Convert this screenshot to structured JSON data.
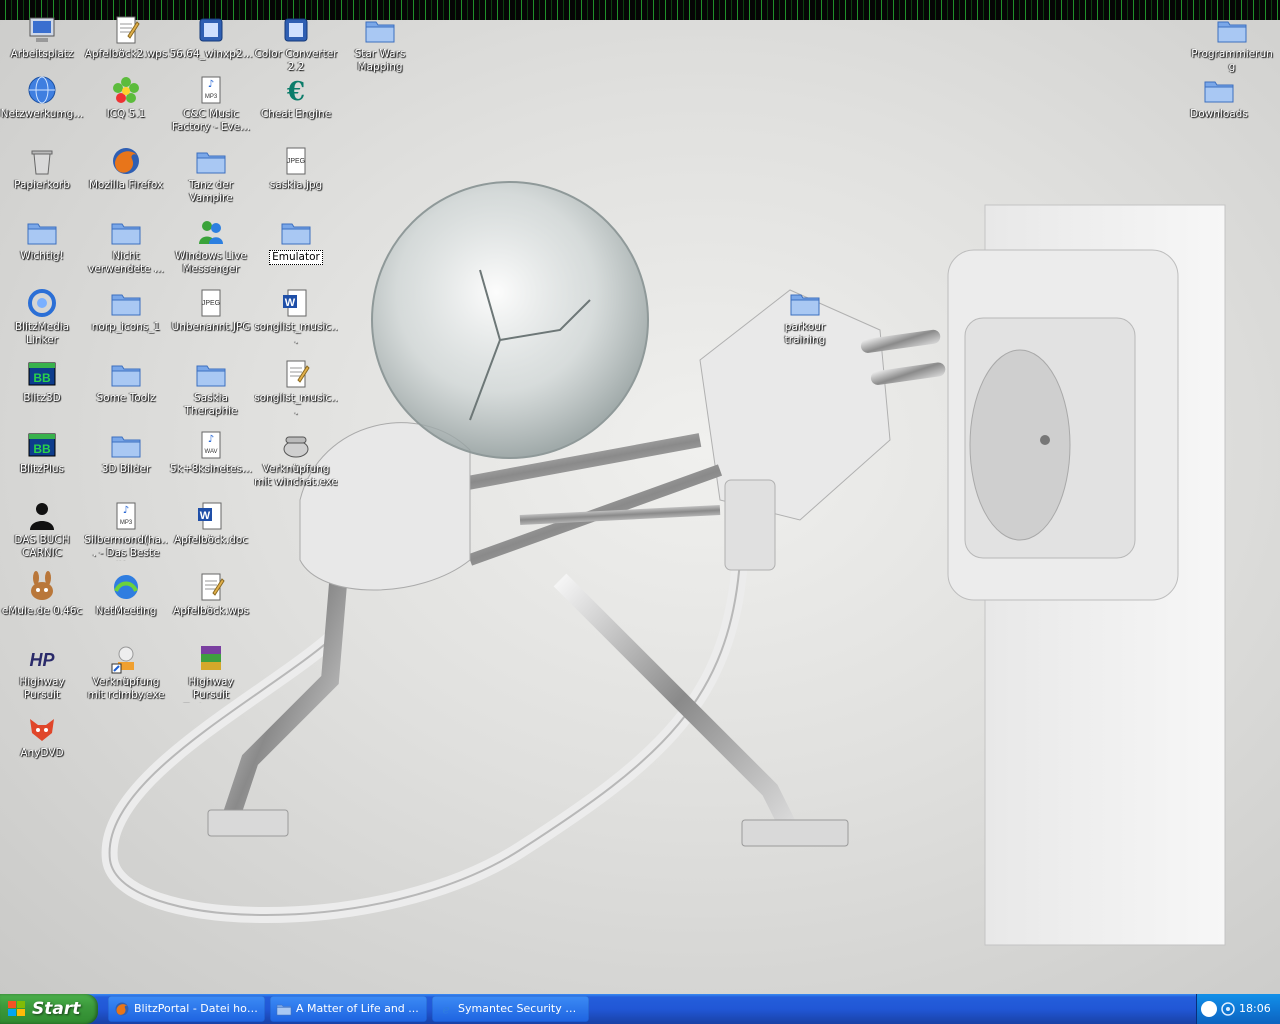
{
  "desktop": {
    "icons": [
      {
        "label": "Arbeitsplatz",
        "icon": "my-computer-icon"
      },
      {
        "label": "Apfelböck2.wps",
        "icon": "document-icon"
      },
      {
        "label": "56.64_winxp2...",
        "icon": "installer-icon"
      },
      {
        "label": "Color Converter 2.2",
        "icon": "app-icon"
      },
      {
        "label": "Star Wars Mapping",
        "icon": "folder-icon"
      },
      {
        "label": "Programmierung",
        "icon": "folder-icon"
      },
      {
        "label": "Netzwerkumg...",
        "icon": "network-icon"
      },
      {
        "label": "ICQ 5.1",
        "icon": "icq-flower-icon"
      },
      {
        "label": "C&C Music Factory - Eve...",
        "icon": "mp3-file-icon"
      },
      {
        "label": "Cheat Engine",
        "icon": "cheat-engine-icon"
      },
      {
        "label": "Downloads",
        "icon": "folder-icon"
      },
      {
        "label": "Papierkorb",
        "icon": "recycle-bin-icon"
      },
      {
        "label": "Mozilla Firefox",
        "icon": "firefox-icon"
      },
      {
        "label": "Tanz der Vampire",
        "icon": "folder-icon"
      },
      {
        "label": "saskia.jpg",
        "icon": "jpeg-file-icon"
      },
      {
        "label": "Wichtig!",
        "icon": "folder-icon"
      },
      {
        "label": "Nicht verwendete ...",
        "icon": "folder-icon"
      },
      {
        "label": "Windows Live Messenger",
        "icon": "messenger-icon"
      },
      {
        "label": "Emulator",
        "icon": "folder-icon"
      },
      {
        "label": "BlitzMedia Linker",
        "icon": "blitzmedia-icon"
      },
      {
        "label": "norp_icons_1",
        "icon": "folder-icon"
      },
      {
        "label": "Unbenannt.JPG",
        "icon": "jpeg-file-icon"
      },
      {
        "label": "songlist_music...",
        "icon": "word-document-icon"
      },
      {
        "label": "parkour training",
        "icon": "folder-icon"
      },
      {
        "label": "Blitz3D",
        "icon": "blitz-bb-icon"
      },
      {
        "label": "Some Toolz",
        "icon": "folder-icon"
      },
      {
        "label": "Saskia Theraphie",
        "icon": "folder-icon"
      },
      {
        "label": "songlist_music...",
        "icon": "notepad-document-icon"
      },
      {
        "label": "BlitzPlus",
        "icon": "blitz-bb-icon"
      },
      {
        "label": "3D Bilder",
        "icon": "folder-icon"
      },
      {
        "label": "5k+8ksinetes...",
        "icon": "wav-file-icon"
      },
      {
        "label": "Verknüpfung mit winchat.exe",
        "icon": "telephone-icon"
      },
      {
        "label": "DAS BUCH CARNIC",
        "icon": "silhouette-icon"
      },
      {
        "label": "Silbermond(ha... - Das Beste (K...",
        "icon": "mp3-file-icon"
      },
      {
        "label": "Apfelböck.doc",
        "icon": "word-document-icon"
      },
      {
        "label": "eMule.de 0.46c",
        "icon": "emule-mule-icon"
      },
      {
        "label": "NetMeeting",
        "icon": "netmeeting-icon"
      },
      {
        "label": "Apfelböck.wps",
        "icon": "document-icon"
      },
      {
        "label": "Highway Pursuit",
        "icon": "hp-logo-icon"
      },
      {
        "label": "Verknüpfung mit rcimby.exe",
        "icon": "shortcut-app-icon"
      },
      {
        "label": "Highway Pursuit Trainer.rar",
        "icon": "rar-archive-icon"
      },
      {
        "label": "AnyDVD",
        "icon": "fox-icon"
      }
    ]
  },
  "taskbar": {
    "start_label": "Start",
    "tasks": [
      {
        "label": "BlitzPortal - Datei hoc...",
        "icon": "firefox-icon"
      },
      {
        "label": "A Matter of Life and ...",
        "icon": "folder-icon"
      },
      {
        "label": "Symantec Security C...",
        "icon": "ie-icon"
      }
    ],
    "clock": "18:06"
  }
}
